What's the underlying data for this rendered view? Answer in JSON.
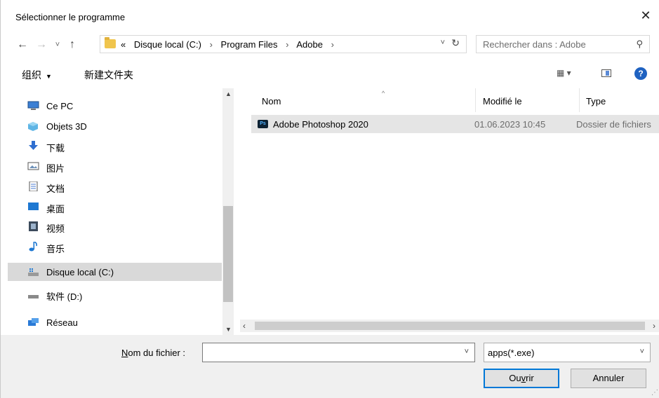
{
  "window": {
    "title": "Sélectionner le programme",
    "close_glyph": "✕"
  },
  "nav": {
    "back_glyph": "←",
    "forward_glyph": "→",
    "recent_glyph": "˅",
    "up_glyph": "↑",
    "breadcrumb": {
      "overflow": "«",
      "items": [
        "Disque local (C:)",
        "Program Files",
        "Adobe"
      ],
      "sep": "›"
    },
    "search_placeholder": "Rechercher dans : Adobe"
  },
  "toolbar": {
    "organize": "组织",
    "new_folder": "新建文件夹"
  },
  "sidebar": {
    "items": [
      {
        "label": "Ce PC",
        "icon": "computer-icon"
      },
      {
        "label": "Objets 3D",
        "icon": "cube-3d-icon"
      },
      {
        "label": "下载",
        "icon": "download-arrow-icon"
      },
      {
        "label": "图片",
        "icon": "pictures-icon"
      },
      {
        "label": "文档",
        "icon": "document-icon"
      },
      {
        "label": "桌面",
        "icon": "desktop-icon"
      },
      {
        "label": "视频",
        "icon": "video-icon"
      },
      {
        "label": "音乐",
        "icon": "music-note-icon"
      },
      {
        "label": "Disque local (C:)",
        "icon": "drive-c-icon",
        "selected": true
      },
      {
        "label": "软件 (D:)",
        "icon": "drive-d-icon"
      },
      {
        "label": "Réseau",
        "icon": "network-icon"
      }
    ]
  },
  "filelist": {
    "columns": [
      "Nom",
      "Modifié le",
      "Type"
    ],
    "rows": [
      {
        "name": "Adobe Photoshop 2020",
        "modified": "01.06.2023 10:45",
        "type": "Dossier de fichiers",
        "icon_text": "Ps"
      }
    ]
  },
  "bottom": {
    "filename_label_pre": "",
    "filename_label_ul": "N",
    "filename_label_post": "om du fichier :",
    "filename_value": "",
    "filter_value": "apps(*.exe)",
    "open_pre": "Ou",
    "open_ul": "v",
    "open_post": "rir",
    "cancel_label": "Annuler"
  },
  "colors": {
    "accent": "#0078d7",
    "selection": "#d9d9d9",
    "ps_bg": "#0e2233",
    "ps_fg": "#4fb1ff"
  }
}
